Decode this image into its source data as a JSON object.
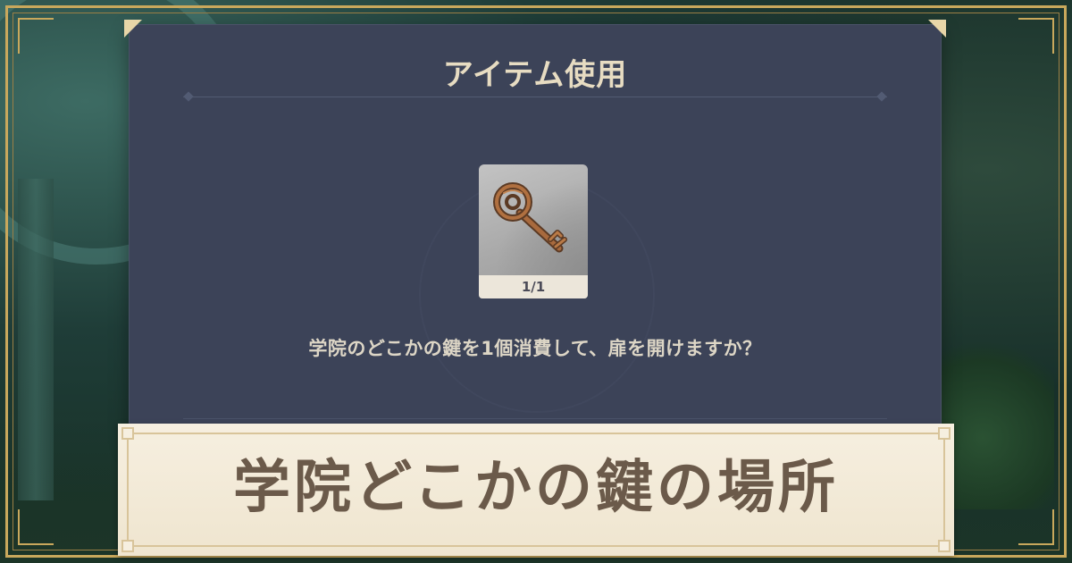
{
  "dialog": {
    "title": "アイテム使用",
    "item": {
      "icon": "key-icon",
      "count": "1/1"
    },
    "message": "学院のどこかの鍵を1個消費して、扉を開けますか？"
  },
  "banner": {
    "title": "学院どこかの鍵の場所"
  },
  "colors": {
    "dialog_bg": "#3c4358",
    "frame_gold": "#c9a85c",
    "title_text": "#e7dcc2",
    "banner_bg": "#f6efe0",
    "banner_text": "#6b5a4a"
  }
}
